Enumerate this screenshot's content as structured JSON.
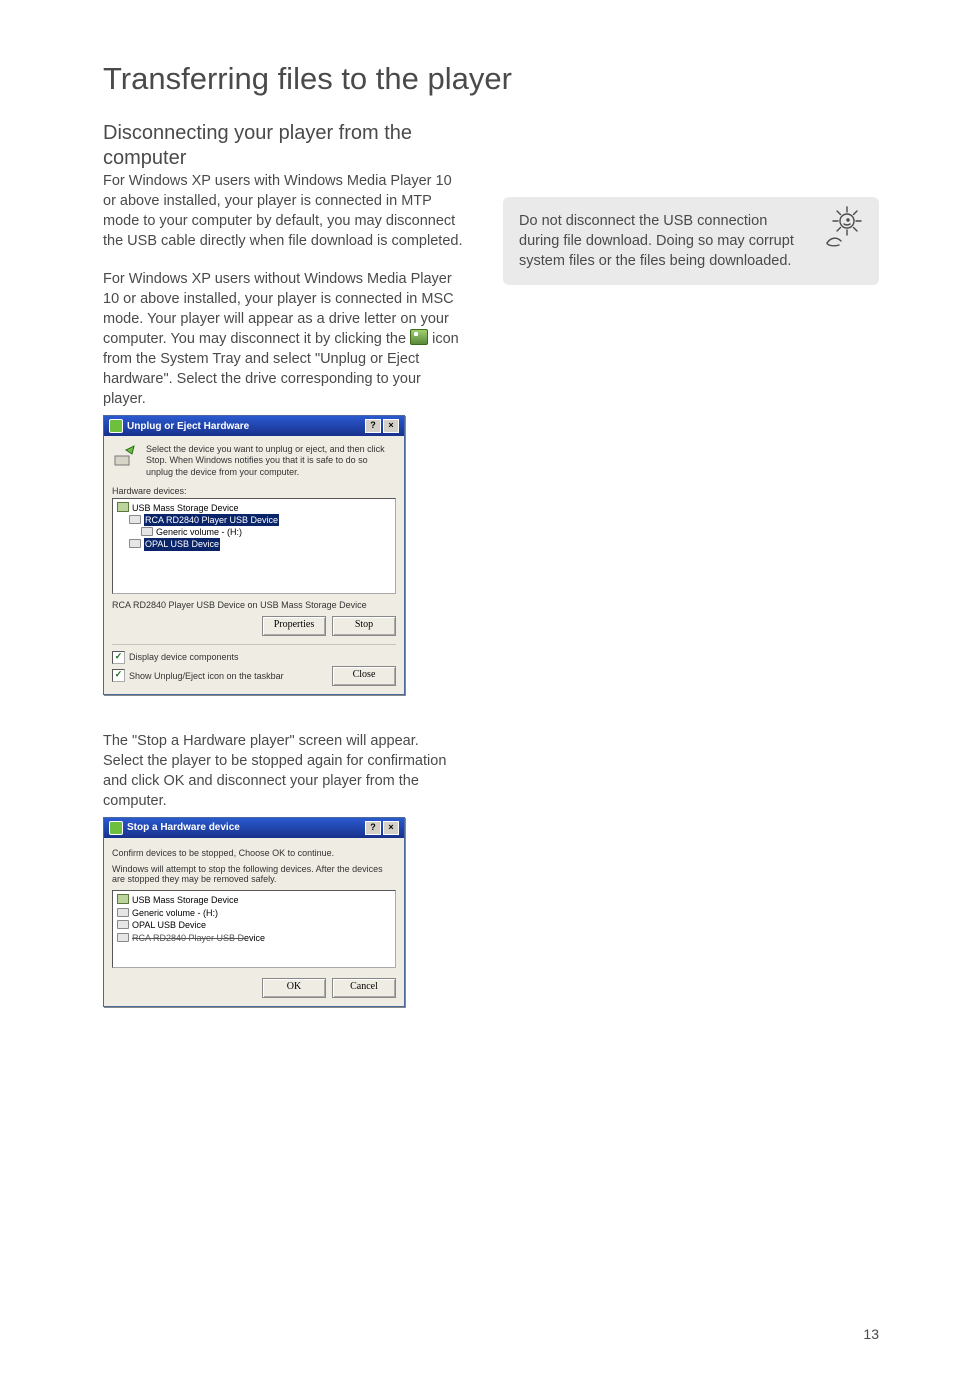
{
  "page": {
    "title": "Transferring files to the player",
    "number": "13"
  },
  "section": {
    "title": "Disconnecting your player from the computer",
    "para1": "For Windows XP users with Windows Media Player 10 or above installed, your player is connected in MTP mode to your computer by default, you may disconnect the USB cable directly when file download is completed.",
    "para2a": "For Windows XP users without Windows Media Player 10 or above installed, your player is connected in MSC  mode. Your player will appear as a drive letter on your computer. You may disconnect it by clicking the ",
    "para2b": " icon from the System Tray and select \"Unplug or Eject hardware\". Select the drive corresponding to your player.",
    "para3": "The \"Stop a Hardware player\" screen will appear. Select the player to be stopped again for confirmation and click OK and disconnect your player from the computer."
  },
  "note": {
    "text": "Do not disconnect the USB connection during file download. Doing so may corrupt system files or the files being downloaded."
  },
  "dlg1": {
    "title": "Unplug or Eject Hardware",
    "help": "?",
    "close": "×",
    "instr": "Select the device you want to unplug or eject, and then click Stop. When Windows notifies you that it is safe to do so unplug the device from your computer.",
    "hw_label": "Hardware devices:",
    "tree": {
      "root": "USB Mass Storage Device",
      "child1": "RCA RD2840 Player USB Device",
      "child2": "Generic volume - (H:)",
      "child3": "OPAL USB Device"
    },
    "status": "RCA RD2840 Player USB Device on USB Mass Storage Device",
    "btn_properties": "Properties",
    "btn_stop": "Stop",
    "chk1": "Display device components",
    "chk2": "Show Unplug/Eject icon on the taskbar",
    "btn_close": "Close"
  },
  "dlg2": {
    "title": "Stop a Hardware device",
    "help": "?",
    "close": "×",
    "line1": "Confirm devices to be stopped, Choose OK to continue.",
    "line2": "Windows will attempt to stop the following devices. After the devices are stopped they may be removed safely.",
    "list": {
      "item1": "USB Mass Storage Device",
      "item2": "Generic volume - (H:)",
      "item3_sel": "OPAL USB Device",
      "item3_tail": "evice"
    },
    "btn_ok": "OK",
    "btn_cancel": "Cancel"
  }
}
